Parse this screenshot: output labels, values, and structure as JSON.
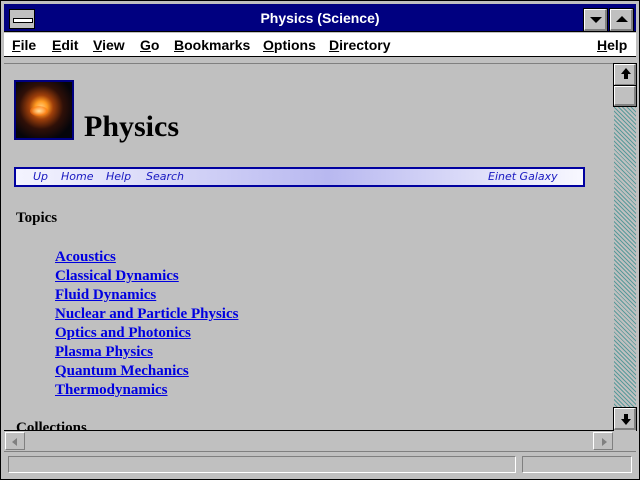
{
  "window": {
    "title": "Physics (Science)"
  },
  "menubar": {
    "items": [
      {
        "underline": "F",
        "rest": "ile"
      },
      {
        "underline": "E",
        "rest": "dit"
      },
      {
        "underline": "V",
        "rest": "iew"
      },
      {
        "underline": "G",
        "rest": "o"
      },
      {
        "underline": "B",
        "rest": "ookmarks"
      },
      {
        "underline": "O",
        "rest": "ptions"
      },
      {
        "underline": "D",
        "rest": "irectory"
      },
      {
        "underline": "H",
        "rest": "elp"
      }
    ]
  },
  "page": {
    "heading": "Physics",
    "navbar": {
      "links": [
        "Up",
        "Home",
        "Help",
        "Search"
      ],
      "brand": "Einet Galaxy"
    },
    "topics_heading": "Topics",
    "topics": [
      "Acoustics",
      "Classical Dynamics",
      "Fluid Dynamics",
      "Nuclear and Particle Physics",
      "Optics and Photonics",
      "Plasma Physics",
      "Quantum Mechanics",
      "Thermodynamics"
    ],
    "collections_heading": "Collections"
  },
  "status": {
    "text": ""
  },
  "colors": {
    "title_bar": "#000080",
    "link": "#0000e0",
    "navbar_border": "#0000a0",
    "background": "#c0c0c0"
  },
  "icons": [
    "system-menu-icon",
    "minimize-icon",
    "maximize-icon",
    "scroll-up-icon",
    "scroll-down-icon",
    "scroll-left-icon",
    "scroll-right-icon"
  ]
}
